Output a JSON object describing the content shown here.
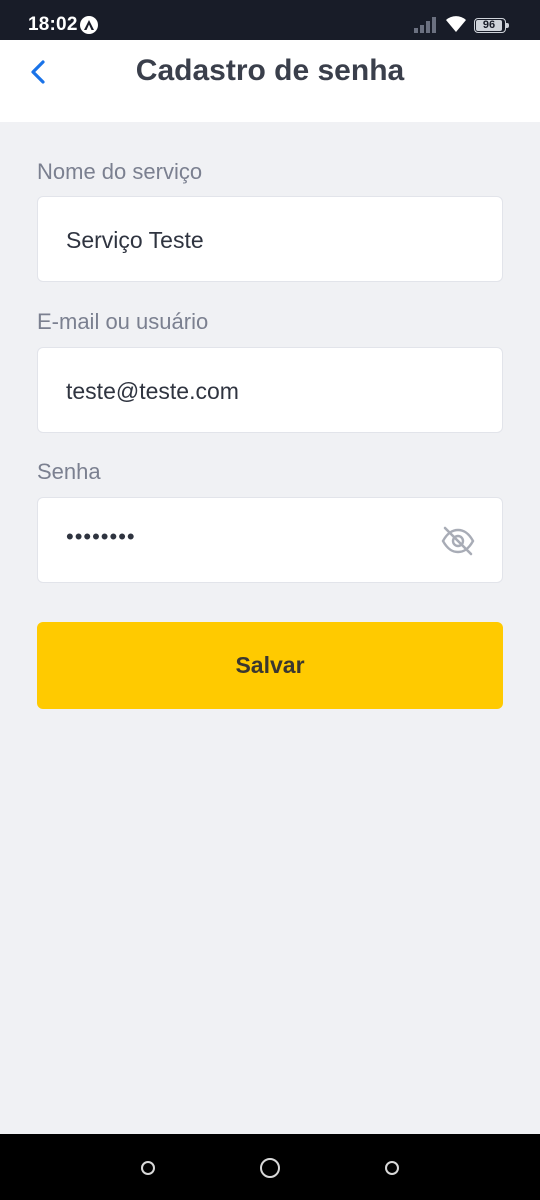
{
  "status_bar": {
    "time": "18:02",
    "battery": "96",
    "icons": [
      "app-notification-icon",
      "signal-icon",
      "wifi-icon",
      "battery-icon"
    ]
  },
  "header": {
    "title": "Cadastro de senha",
    "back_icon": "chevron-left-icon",
    "accent_color": "#1a73e8"
  },
  "form": {
    "service": {
      "label": "Nome do serviço",
      "value": "Serviço Teste"
    },
    "user": {
      "label": "E-mail ou usuário",
      "value": "teste@teste.com"
    },
    "password": {
      "label": "Senha",
      "value_masked": "••••••••",
      "toggle_icon": "eye-off-icon"
    },
    "save_label": "Salvar",
    "save_color": "#ffca00"
  },
  "nav_bar": {
    "icons": [
      "recents-icon",
      "home-icon",
      "back-icon"
    ]
  }
}
